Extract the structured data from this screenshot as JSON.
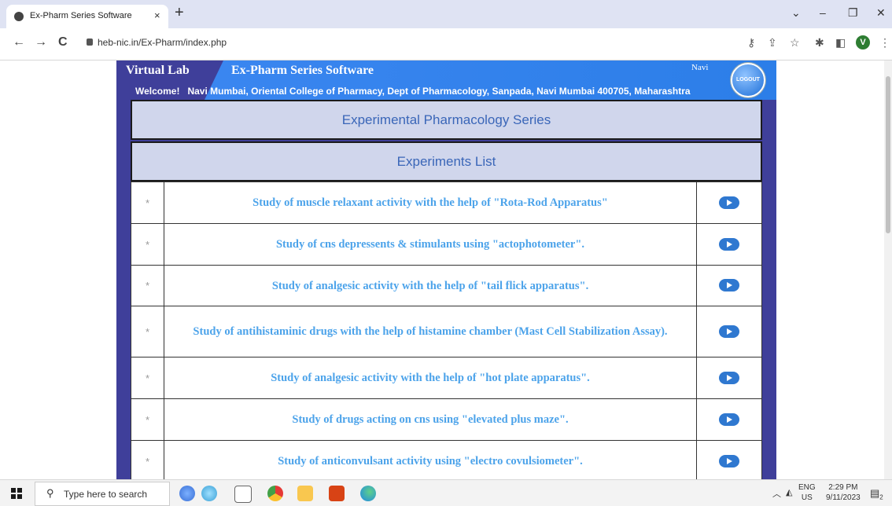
{
  "browser": {
    "tab_title": "Ex-Pharm Series Software",
    "tab_close": "×",
    "new_tab": "+",
    "url": "heb-nic.in/Ex-Pharm/index.php",
    "back": "←",
    "forward": "→",
    "reload": "C",
    "profile_initial": "V",
    "minimize": "–",
    "maximize": "❐",
    "close": "✕",
    "chevron": "⌄"
  },
  "header": {
    "virtual_lab": "Virtual Lab",
    "app_title": "Ex-Pharm Series Software",
    "user_short": "Navi",
    "logout_label": "LOGOUT",
    "welcome_label": "Welcome!",
    "welcome_text": "Navi Mumbai, Oriental College of Pharmacy, Dept of Pharmacology, Sanpada, Navi Mumbai 400705, Maharashtra"
  },
  "series_title": "Experimental Pharmacology Series",
  "list_title": "Experiments List",
  "experiments": [
    {
      "bullet": "*",
      "title": "Study of muscle relaxant activity with the help of \"Rota-Rod Apparatus\""
    },
    {
      "bullet": "*",
      "title": "Study of cns depressents & stimulants using \"actophotometer\"."
    },
    {
      "bullet": "*",
      "title": "Study of analgesic activity with the help of \"tail flick apparatus\"."
    },
    {
      "bullet": "*",
      "title": "Study of antihistaminic drugs with the help of histamine chamber (Mast Cell Stabilization Assay)."
    },
    {
      "bullet": "*",
      "title": "Study of analgesic activity with the help of \"hot plate apparatus\"."
    },
    {
      "bullet": "*",
      "title": "Study of drugs acting on cns using \"elevated plus maze\"."
    },
    {
      "bullet": "*",
      "title": "Study of anticonvulsant activity using \"electro covulsiometer\"."
    },
    {
      "bullet": "",
      "title": ""
    }
  ],
  "taskbar": {
    "search_placeholder": "Type here to search",
    "lang_top": "ENG",
    "lang_bottom": "US",
    "time": "2:29 PM",
    "date": "9/11/2023",
    "notif_count": "2"
  }
}
